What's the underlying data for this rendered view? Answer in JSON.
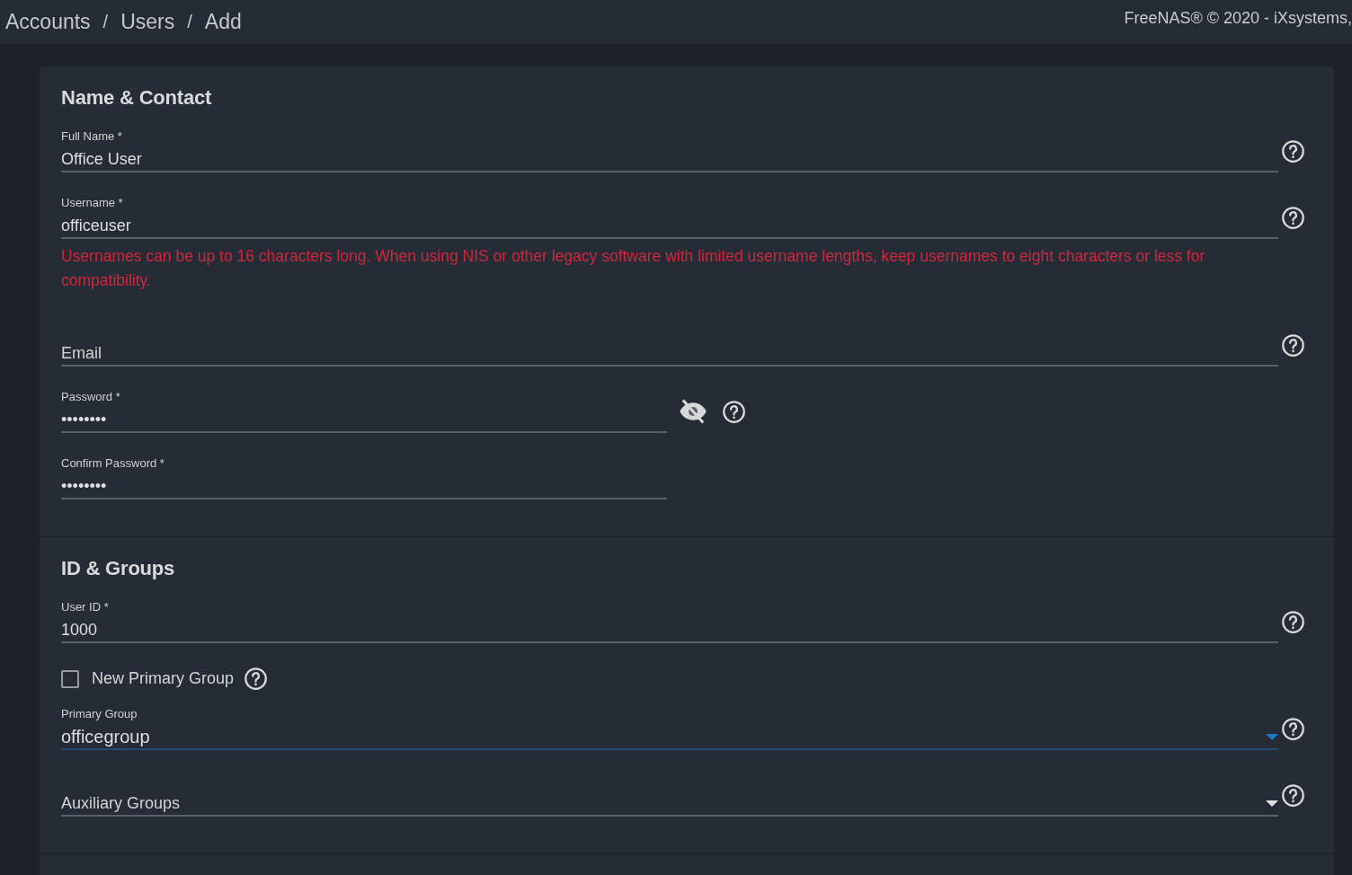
{
  "breadcrumb": [
    {
      "kind": "link",
      "text": "Accounts"
    },
    {
      "kind": "separator",
      "text": "/"
    },
    {
      "kind": "link",
      "text": "Users"
    },
    {
      "kind": "separator",
      "text": "/"
    },
    {
      "kind": "current",
      "text": "Add"
    }
  ],
  "copyright": "FreeNAS® © 2020 - iXsystems,",
  "sections": [
    {
      "title": "Name & Contact",
      "fields": [
        {
          "kind": "text",
          "label": "Full Name *",
          "value": "Office User",
          "help": true
        },
        {
          "kind": "text",
          "label": "Username *",
          "value": "officeuser",
          "help": true,
          "error": "Usernames can be up to 16 characters long. When using NIS or other legacy software with limited username lengths, keep usernames to eight characters or less for compatibility."
        },
        {
          "kind": "text",
          "placeholder": "Email",
          "help": true
        },
        {
          "kind": "password",
          "label": "Password *",
          "value": "••••••••",
          "password_visible": false,
          "help": true
        },
        {
          "kind": "password",
          "label": "Confirm Password *",
          "value": "••••••••",
          "help": false
        }
      ]
    },
    {
      "title": "ID & Groups",
      "fields": [
        {
          "kind": "text",
          "label": "User ID *",
          "value": "1000",
          "help": true
        },
        {
          "kind": "checkbox",
          "label": "New Primary Group",
          "checked": false,
          "help": true
        },
        {
          "kind": "select",
          "label": "Primary Group",
          "value": "officegroup",
          "focused": true,
          "help": true
        },
        {
          "kind": "select",
          "placeholder": "Auxiliary Groups",
          "focused": false,
          "help": true
        }
      ]
    }
  ]
}
